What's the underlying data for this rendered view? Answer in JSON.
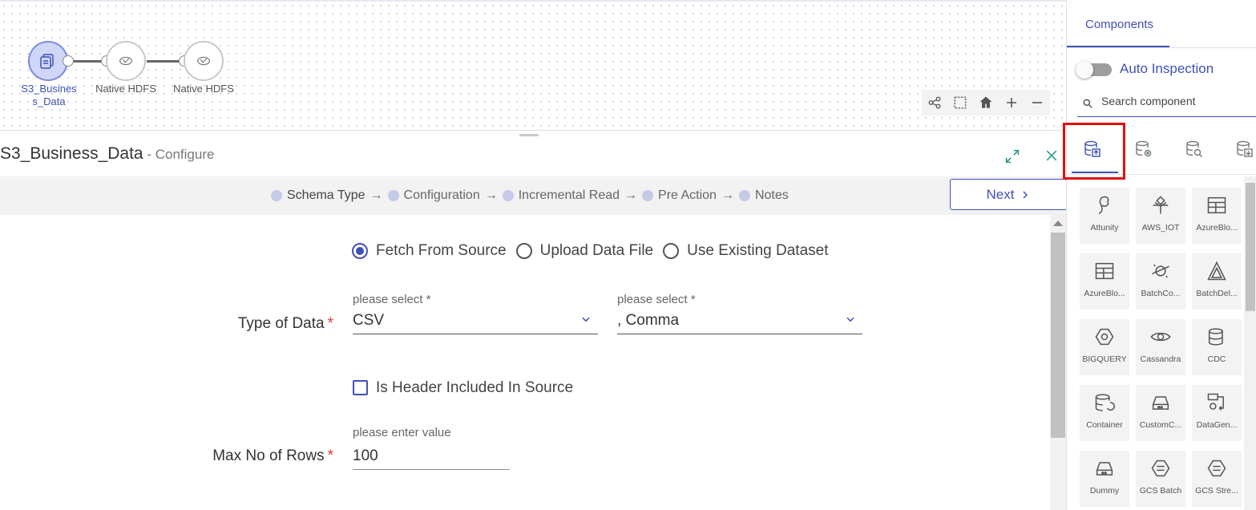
{
  "pipeline": {
    "nodes": [
      {
        "label": "S3_Business_Data",
        "label_lines": [
          "S3_Busines",
          "s_Data"
        ],
        "active": true,
        "icon": "s3-source-icon"
      },
      {
        "label": "Native HDFS",
        "active": false,
        "icon": "hdfs-icon"
      },
      {
        "label": "Native HDFS",
        "active": false,
        "icon": "hdfs-icon"
      }
    ],
    "toolbar": [
      "share-icon",
      "select-area-icon",
      "home-icon",
      "zoom-in-icon",
      "zoom-out-icon"
    ]
  },
  "configure": {
    "title": "S3_Business_Data",
    "subtitle": " - Configure"
  },
  "stepper": {
    "steps": [
      "Schema Type",
      "Configuration",
      "Incremental Read",
      "Pre Action",
      "Notes"
    ],
    "next_label": "Next"
  },
  "form": {
    "source_options": [
      {
        "label": "Fetch From Source",
        "checked": true
      },
      {
        "label": "Upload Data File",
        "checked": false
      },
      {
        "label": "Use Existing Dataset",
        "checked": false
      }
    ],
    "type_of_data_label": "Type of Data",
    "type_select_label": "please select *",
    "type_value": "CSV",
    "delimiter_select_label": "please select *",
    "delimiter_value": ", Comma",
    "header_checkbox_label": "Is Header Included In Source",
    "header_checked": false,
    "max_rows_label": "Max No of Rows",
    "max_rows_hint": "please enter value",
    "max_rows_value": "100",
    "required_mark": "*"
  },
  "panel": {
    "tab_label": "Components",
    "auto_inspection_label": "Auto Inspection",
    "auto_inspection_on": false,
    "search_placeholder": "Search component",
    "categories": [
      "data-source-icon",
      "data-process-icon",
      "data-analytics-icon",
      "data-sink-icon"
    ],
    "components": [
      "Attunity",
      "AWS_IOT",
      "AzureBlo...",
      "AzureBlo...",
      "BatchCo...",
      "BatchDel...",
      "BIGQUERY",
      "Cassandra",
      "CDC",
      "Container",
      "CustomC...",
      "DataGen...",
      "Dummy",
      "GCS Batch",
      "GCS Stre..."
    ]
  },
  "colors": {
    "accent": "#3f51b5",
    "teal": "#2e9d8f",
    "required": "#e53935",
    "highlight": "#e01010"
  }
}
